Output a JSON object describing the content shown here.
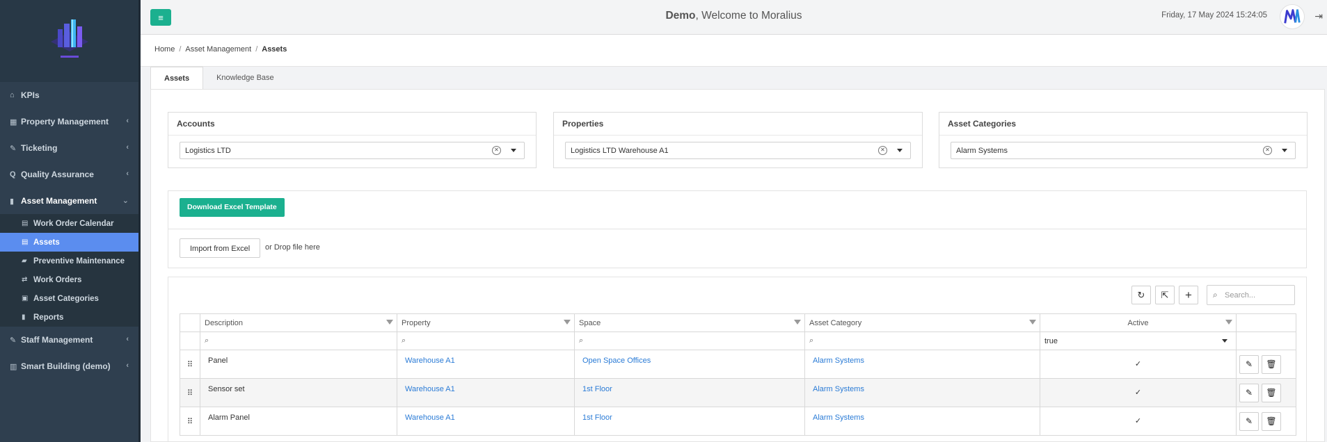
{
  "header": {
    "user": "Demo",
    "welcome": ", Welcome to Moralius",
    "datetime": "Friday, 17 May 2024 15:24:05"
  },
  "sidebar": {
    "items": [
      {
        "label": "KPIs",
        "icon": "home-icon"
      },
      {
        "label": "Property Management",
        "icon": "building-icon"
      },
      {
        "label": "Ticketing",
        "icon": "ticket-icon"
      },
      {
        "label": "Quality Assurance",
        "icon": "search-icon"
      },
      {
        "label": "Asset Management",
        "icon": "book-icon"
      },
      {
        "label": "Staff Management",
        "icon": "tag-icon"
      },
      {
        "label": "Smart Building (demo)",
        "icon": "chart-icon"
      }
    ],
    "asset_sub": [
      {
        "label": "Work Order Calendar",
        "icon": "calendar-icon"
      },
      {
        "label": "Assets",
        "icon": "list-icon"
      },
      {
        "label": "Preventive Maintenance",
        "icon": "truck-icon"
      },
      {
        "label": "Work Orders",
        "icon": "retweet-icon"
      },
      {
        "label": "Asset Categories",
        "icon": "cubes-icon"
      },
      {
        "label": "Reports",
        "icon": "book-icon"
      }
    ]
  },
  "breadcrumb": {
    "home": "Home",
    "section": "Asset Management",
    "current": "Assets"
  },
  "tabs": [
    {
      "label": "Assets"
    },
    {
      "label": "Knowledge Base"
    }
  ],
  "filters": {
    "accounts": {
      "title": "Accounts",
      "value": "Logistics LTD"
    },
    "properties": {
      "title": "Properties",
      "value": "Logistics LTD Warehouse A1"
    },
    "categories": {
      "title": "Asset Categories",
      "value": "Alarm Systems"
    }
  },
  "actions": {
    "download_label": "Download Excel Template",
    "import_label": "Import from Excel",
    "drop_text": "or Drop file here",
    "search_placeholder": "Search..."
  },
  "grid": {
    "columns": [
      "Description",
      "Property",
      "Space",
      "Asset Category",
      "Active"
    ],
    "active_filter": "true",
    "rows": [
      {
        "description": "Panel",
        "property": "Warehouse A1",
        "space": "Open Space Offices",
        "category": "Alarm Systems",
        "active": true
      },
      {
        "description": "Sensor set",
        "property": "Warehouse A1",
        "space": "1st Floor",
        "category": "Alarm Systems",
        "active": true
      },
      {
        "description": "Alarm Panel",
        "property": "Warehouse A1",
        "space": "1st Floor",
        "category": "Alarm Systems",
        "active": true
      }
    ]
  },
  "colors": {
    "accent": "#1bb08f",
    "sidebar": "#2f3f4f",
    "selected": "#5b8def",
    "link": "#2a7bd6"
  }
}
